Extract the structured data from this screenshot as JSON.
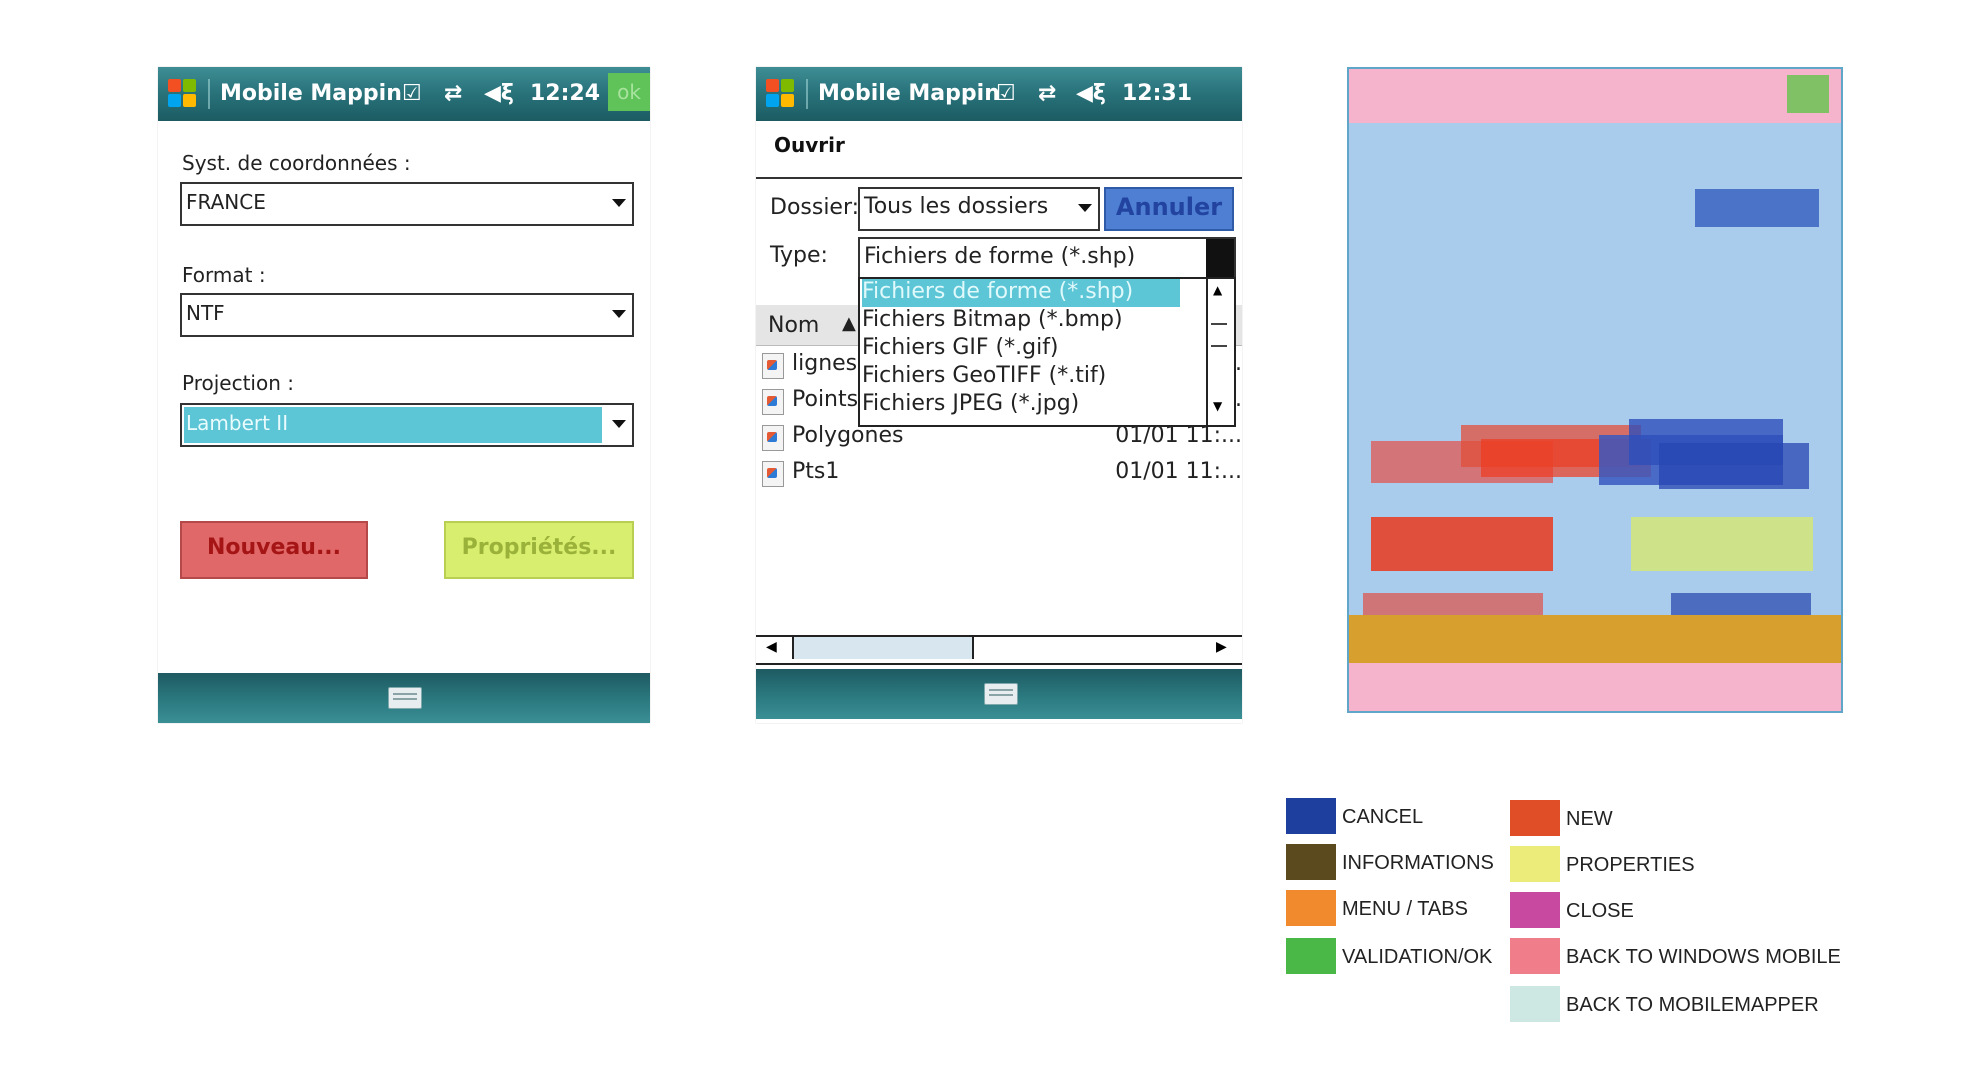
{
  "phone1": {
    "title": "Mobile Mappin",
    "time": "12:24",
    "ok_label": "ok",
    "fields": [
      {
        "label": "Syst. de coordonnées :",
        "value": "FRANCE"
      },
      {
        "label": "Format :",
        "value": "NTF"
      },
      {
        "label": "Projection :",
        "value": "Lambert II"
      }
    ],
    "new_button": "Nouveau...",
    "properties_button": "Propriétés..."
  },
  "phone2": {
    "title": "Mobile Mappin",
    "time": "12:31",
    "menu_title": "Ouvrir",
    "folder_label": "Dossier:",
    "folder_value": "Tous les dossiers",
    "cancel_button": "Annuler",
    "type_label": "Type:",
    "type_value": "Fichiers de forme (*.shp)",
    "type_options": [
      "Fichiers de forme (*.shp)",
      "Fichiers Bitmap (*.bmp)",
      "Fichiers GIF (*.gif)",
      "Fichiers GeoTIFF (*.tif)",
      "Fichiers JPEG (*.jpg)"
    ],
    "column_name": "Nom",
    "files": [
      {
        "name": "lignes",
        "date": "..."
      },
      {
        "name": "Points",
        "date": "..."
      },
      {
        "name": "Polygones",
        "date": "01/01 11:..."
      },
      {
        "name": "Pts1",
        "date": "01/01 11:..."
      }
    ]
  },
  "legend": {
    "items": [
      {
        "label": "CANCEL",
        "color": "#1f3f9e"
      },
      {
        "label": "NEW",
        "color": "#e04e28"
      },
      {
        "label": "INFORMATIONS",
        "color": "#5a4a1e"
      },
      {
        "label": "PROPERTIES",
        "color": "#ecec7a"
      },
      {
        "label": "MENU / TABS",
        "color": "#f08a2c"
      },
      {
        "label": "CLOSE",
        "color": "#c84aa0"
      },
      {
        "label": "VALIDATION/OK",
        "color": "#49b846"
      },
      {
        "label": "BACK TO WINDOWS MOBILE",
        "color": "#f07e8a"
      },
      {
        "label": "BACK TO MOBILEMAPPER",
        "color": "#cde8e2"
      }
    ]
  },
  "colors": {
    "titlebar": "#2a747c",
    "highlight": "#5cc5d6",
    "heat_background": "#aaccec"
  }
}
